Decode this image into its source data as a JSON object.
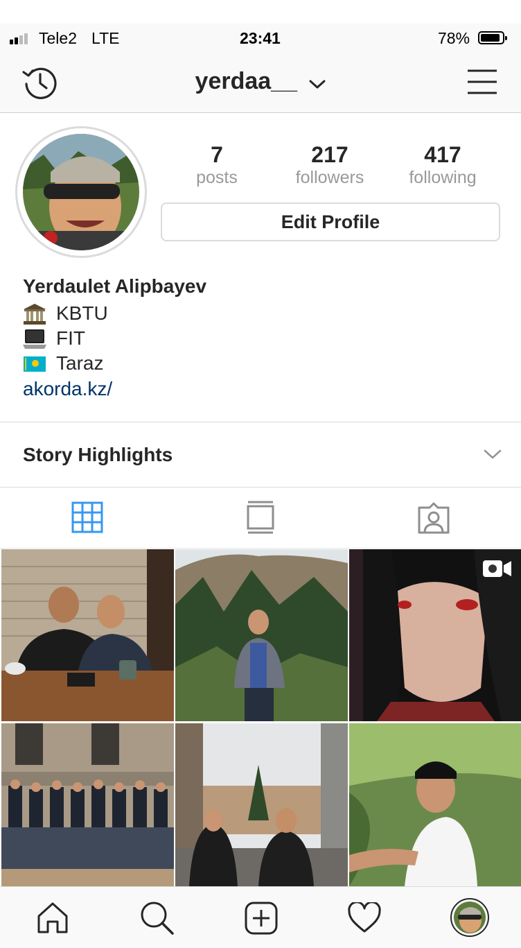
{
  "status_bar": {
    "carrier": "Tele2",
    "network": "LTE",
    "time": "23:41",
    "battery": "78%",
    "battery_level": 0.78
  },
  "nav": {
    "username": "yerdaa__",
    "history_icon": "history-icon",
    "menu_icon": "hamburger-menu-icon",
    "dropdown_icon": "chevron-down-icon"
  },
  "profile": {
    "stats": [
      {
        "value": "7",
        "label": "posts"
      },
      {
        "value": "217",
        "label": "followers"
      },
      {
        "value": "417",
        "label": "following"
      }
    ],
    "edit_button": "Edit Profile",
    "full_name": "Yerdaulet Alipbayev",
    "bio": [
      {
        "emoji": "classical-building",
        "text": "KBTU"
      },
      {
        "emoji": "laptop",
        "text": "FIT"
      },
      {
        "emoji": "kazakhstan-flag",
        "text": "Taraz"
      }
    ],
    "website": "akorda.kz/"
  },
  "highlights": {
    "title": "Story Highlights"
  },
  "view_tabs": [
    {
      "name": "grid-view-icon",
      "active": true
    },
    {
      "name": "feed-view-icon",
      "active": false
    },
    {
      "name": "tagged-photos-icon",
      "active": false
    }
  ],
  "colors": {
    "accent_blue": "#3897f0",
    "link": "#003569",
    "text": "#262626",
    "muted": "#999999",
    "border": "#dbdbdb"
  },
  "bottom_tabs": [
    {
      "name": "home-icon"
    },
    {
      "name": "search-icon"
    },
    {
      "name": "new-post-icon"
    },
    {
      "name": "activity-heart-icon"
    },
    {
      "name": "profile-avatar-icon"
    }
  ]
}
